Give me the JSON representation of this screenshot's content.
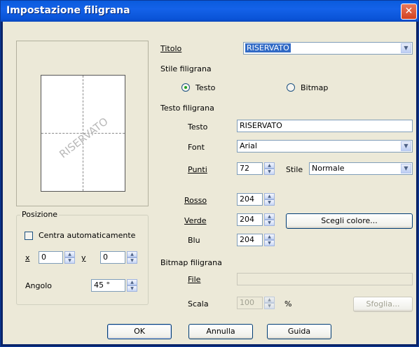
{
  "window": {
    "title": "Impostazione filigrana",
    "close_glyph": "✕"
  },
  "preview": {
    "watermark_text": "RISERVATO"
  },
  "titolo": {
    "label": "Titolo",
    "value": "RISERVATO"
  },
  "stile": {
    "label": "Stile filigrana",
    "option_testo": "Testo",
    "option_bitmap": "Bitmap",
    "selected": "Testo"
  },
  "testo_filigrana": {
    "label": "Testo filigrana",
    "testo_label": "Testo",
    "testo_value": "RISERVATO",
    "font_label": "Font",
    "font_value": "Arial",
    "punti_label": "Punti",
    "punti_value": "72",
    "stile_label": "Stile",
    "stile_value": "Normale"
  },
  "colore": {
    "rosso_label": "Rosso",
    "rosso_value": "204",
    "verde_label": "Verde",
    "verde_value": "204",
    "blu_label": "Blu",
    "blu_value": "204",
    "scegli_label": "Scegli colore..."
  },
  "bitmap": {
    "label": "Bitmap filigrana",
    "file_label": "File",
    "file_value": "",
    "scala_label": "Scala",
    "scala_value": "100",
    "scala_unit": "%",
    "sfoglia_label": "Sfoglia..."
  },
  "posizione": {
    "label": "Posizione",
    "centra_label": "Centra automaticamente",
    "centra_checked": false,
    "x_label": "x",
    "x_value": "0",
    "y_label": "y",
    "y_value": "0",
    "angolo_label": "Angolo",
    "angolo_value": "45 °"
  },
  "buttons": {
    "ok": "OK",
    "annulla": "Annulla",
    "guida": "Guida"
  },
  "colors": {
    "titlebar": "#0a5bdc",
    "face": "#ece9d8",
    "close": "#d2421f"
  }
}
